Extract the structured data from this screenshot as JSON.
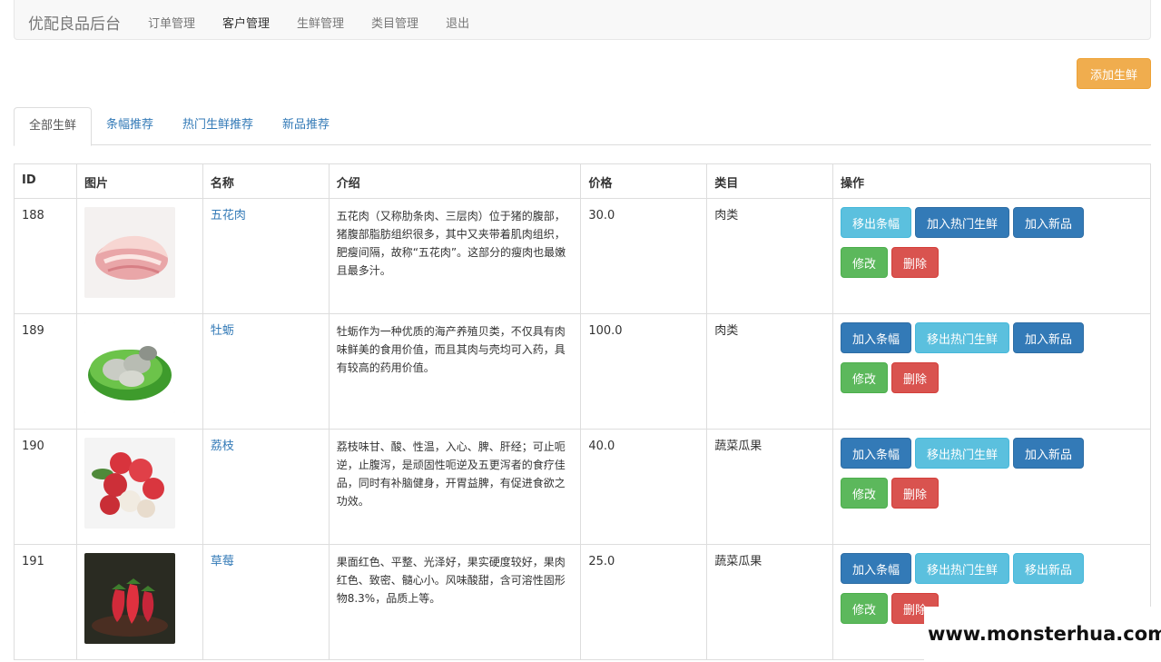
{
  "navbar": {
    "brand": "优配良品后台",
    "links": [
      {
        "label": "订单管理",
        "active": false
      },
      {
        "label": "客户管理",
        "active": true
      },
      {
        "label": "生鲜管理",
        "active": false
      },
      {
        "label": "类目管理",
        "active": false
      },
      {
        "label": "退出",
        "active": false
      }
    ]
  },
  "toolbar": {
    "add_label": "添加生鲜"
  },
  "tabs": [
    "全部生鲜",
    "条幅推荐",
    "热门生鲜推荐",
    "新品推荐"
  ],
  "table": {
    "headers": [
      "ID",
      "图片",
      "名称",
      "介绍",
      "价格",
      "类目",
      "操作"
    ],
    "rows": [
      {
        "id": "188",
        "image": "pork-belly-image",
        "name": "五花肉",
        "desc": "五花肉（又称肋条肉、三层肉）位于猪的腹部，猪腹部脂肪组织很多，其中又夹带着肌肉组织，肥瘦间隔，故称“五花肉”。这部分的瘦肉也最嫩且最多汁。",
        "price": "30.0",
        "category": "肉类",
        "banner_btn": "移出条幅",
        "hot_btn": "加入热门生鲜",
        "new_btn": "加入新品",
        "edit_btn": "修改",
        "delete_btn": "删除"
      },
      {
        "id": "189",
        "image": "oyster-image",
        "name": "牡蛎",
        "desc": "牡蛎作为一种优质的海产养殖贝类，不仅具有肉味鲜美的食用价值，而且其肉与壳均可入药，具有较高的药用价值。",
        "price": "100.0",
        "category": "肉类",
        "banner_btn": "加入条幅",
        "hot_btn": "移出热门生鲜",
        "new_btn": "加入新品",
        "edit_btn": "修改",
        "delete_btn": "删除"
      },
      {
        "id": "190",
        "image": "lychee-image",
        "name": "荔枝",
        "desc": "荔枝味甘、酸、性温，入心、脾、肝经；可止呃逆，止腹泻，是顽固性呃逆及五更泻者的食疗佳品，同时有补脑健身，开胃益脾，有促进食欲之功效。",
        "price": "40.0",
        "category": "蔬菜瓜果",
        "banner_btn": "加入条幅",
        "hot_btn": "移出热门生鲜",
        "new_btn": "加入新品",
        "edit_btn": "修改",
        "delete_btn": "删除"
      },
      {
        "id": "191",
        "image": "strawberry-image",
        "name": "草莓",
        "desc": "果面红色、平整、光泽好，果实硬度较好，果肉红色、致密、髓心小。风味酸甜，含可溶性固形物8.3%，品质上等。",
        "price": "25.0",
        "category": "蔬菜瓜果",
        "banner_btn": "加入条幅",
        "hot_btn": "移出热门生鲜",
        "new_btn": "移出新品",
        "edit_btn": "修改",
        "delete_btn": "删除"
      }
    ]
  },
  "watermark": "www.monsterhua.com"
}
